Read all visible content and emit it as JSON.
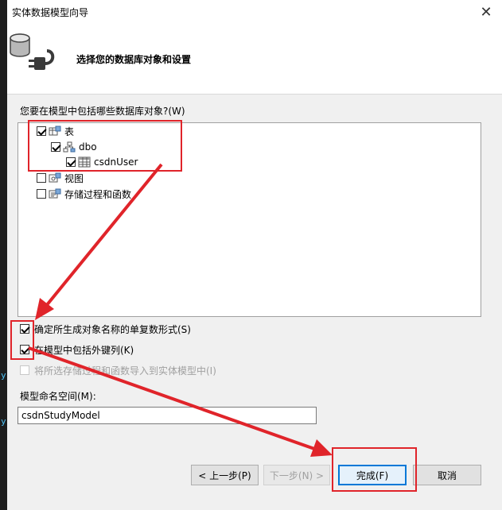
{
  "window": {
    "title": "实体数据模型向导",
    "close_glyph": "✕"
  },
  "header": {
    "title": "选择您的数据库对象和设置"
  },
  "tree_section": {
    "label": "您要在模型中包括哪些数据库对象?(W)",
    "nodes": [
      {
        "label": "表",
        "checked": true
      },
      {
        "label": "dbo",
        "checked": true
      },
      {
        "label": "csdnUser",
        "checked": true
      },
      {
        "label": "视图",
        "checked": false
      },
      {
        "label": "存储过程和函数",
        "checked": false
      }
    ]
  },
  "options": [
    {
      "label": "确定所生成对象名称的单复数形式(S)",
      "checked": true,
      "enabled": true
    },
    {
      "label": "在模型中包括外键列(K)",
      "checked": true,
      "enabled": true
    },
    {
      "label": "将所选存储过程和函数导入到实体模型中(I)",
      "checked": false,
      "enabled": false
    }
  ],
  "namespace": {
    "label": "模型命名空间(M):",
    "value": "csdnStudyModel"
  },
  "buttons": {
    "prev": "< 上一步(P)",
    "next": "下一步(N) >",
    "finish": "完成(F)",
    "cancel": "取消"
  },
  "colors": {
    "annotation": "#e0242a",
    "accent": "#0078d7"
  }
}
